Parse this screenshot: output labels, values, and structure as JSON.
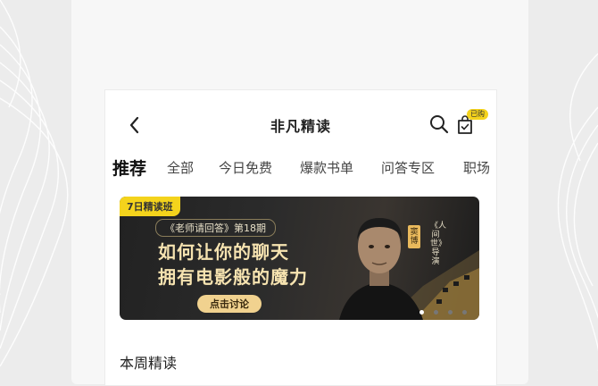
{
  "header": {
    "title": "非凡精读",
    "purchased_badge": "已购"
  },
  "tabs": [
    {
      "label": "推荐",
      "active": true
    },
    {
      "label": "全部"
    },
    {
      "label": "今日免费"
    },
    {
      "label": "爆款书单"
    },
    {
      "label": "问答专区"
    },
    {
      "label": "职场"
    }
  ],
  "banner": {
    "tag": "7日精读班",
    "issue": "《老师请回答》第18期",
    "headline_line1": "如何让你的聊天",
    "headline_line2": "拥有电影般的魔力",
    "cta": "点击讨论",
    "guest_name": "窦博",
    "guest_role": "《人间世》导演",
    "slide_count": 4,
    "active_slide": 1
  },
  "section": {
    "title": "本周精读"
  },
  "colors": {
    "accent_yellow": "#f4d31c",
    "banner_gold_text": "#f6e3b0",
    "banner_button": "#f1d28f"
  }
}
